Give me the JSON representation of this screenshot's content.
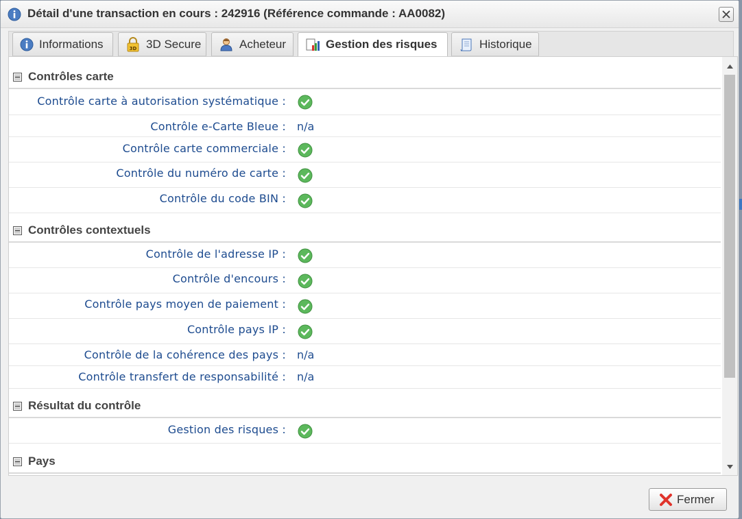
{
  "dialog": {
    "title": "Détail d'une transaction en cours : 242916 (Référence commande : AA0082)"
  },
  "tabs": [
    {
      "label": "Informations",
      "icon": "info-icon",
      "active": false
    },
    {
      "label": "3D Secure",
      "icon": "lock-3d-icon",
      "active": false
    },
    {
      "label": "Acheteur",
      "icon": "user-icon",
      "active": false
    },
    {
      "label": "Gestion des risques",
      "icon": "risk-chart-icon",
      "active": true
    },
    {
      "label": "Historique",
      "icon": "scroll-document-icon",
      "active": false
    }
  ],
  "sections": [
    {
      "title": "Contrôles carte",
      "rows": [
        {
          "label": "Contrôle carte à autorisation systématique :",
          "value": "ok"
        },
        {
          "label": "Contrôle e-Carte Bleue :",
          "value": "n/a"
        },
        {
          "label": "Contrôle carte commerciale :",
          "value": "ok"
        },
        {
          "label": "Contrôle du numéro de carte :",
          "value": "ok"
        },
        {
          "label": "Contrôle du code BIN :",
          "value": "ok"
        }
      ]
    },
    {
      "title": "Contrôles contextuels",
      "rows": [
        {
          "label": "Contrôle de l'adresse IP :",
          "value": "ok"
        },
        {
          "label": "Contrôle d'encours :",
          "value": "ok"
        },
        {
          "label": "Contrôle pays moyen de paiement :",
          "value": "ok"
        },
        {
          "label": "Contrôle pays IP :",
          "value": "ok"
        },
        {
          "label": "Contrôle de la cohérence des pays :",
          "value": "n/a"
        },
        {
          "label": "Contrôle transfert de responsabilité :",
          "value": "n/a"
        }
      ]
    },
    {
      "title": "Résultat du contrôle",
      "rows": [
        {
          "label": "Gestion des risques :",
          "value": "ok"
        }
      ]
    },
    {
      "title": "Pays",
      "rows": []
    }
  ],
  "footer": {
    "close_label": "Fermer"
  },
  "colors": {
    "label_blue": "#1d4b8f",
    "ok_green": "#5cb85c",
    "close_red": "#e0332b"
  }
}
